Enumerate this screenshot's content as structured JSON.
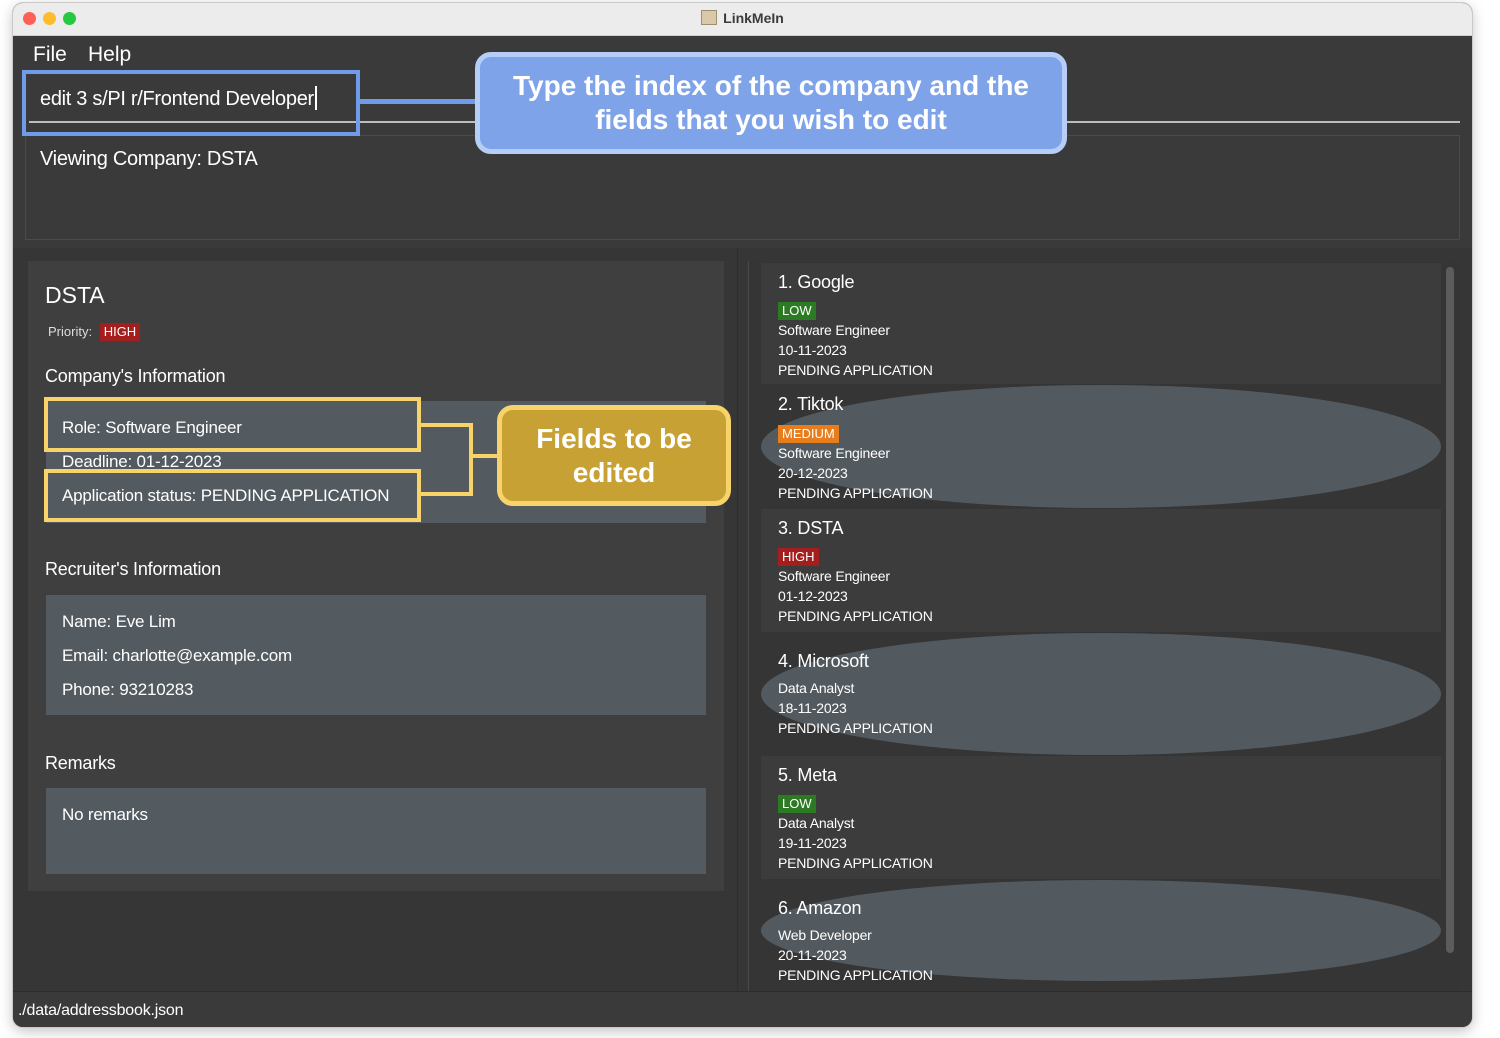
{
  "window": {
    "title": "LinkMeIn"
  },
  "menu": {
    "file": "File",
    "help": "Help"
  },
  "command": {
    "value": "edit 3 s/PI r/Frontend Developer"
  },
  "result": {
    "text": "Viewing Company: DSTA"
  },
  "detail": {
    "name": "DSTA",
    "priority_label": "Priority:",
    "priority": "HIGH",
    "company_section": "Company's Information",
    "role": "Role: Software Engineer",
    "deadline": "Deadline: 01-12-2023",
    "status": "Application status: PENDING APPLICATION",
    "recruiter_section": "Recruiter's Information",
    "recruiter_name": "Name: Eve Lim",
    "recruiter_email": "Email: charlotte@example.com",
    "recruiter_phone": "Phone: 93210283",
    "remarks_section": "Remarks",
    "remarks": "No remarks"
  },
  "companies": [
    {
      "title": "1.  Google",
      "priority": "LOW",
      "role": "Software Engineer",
      "deadline": "10-11-2023",
      "status": "PENDING APPLICATION"
    },
    {
      "title": "2.  Tiktok",
      "priority": "MEDIUM",
      "role": "Software Engineer",
      "deadline": "20-12-2023",
      "status": "PENDING APPLICATION"
    },
    {
      "title": "3.  DSTA",
      "priority": "HIGH",
      "role": "Software Engineer",
      "deadline": "01-12-2023",
      "status": "PENDING APPLICATION"
    },
    {
      "title": "4.  Microsoft",
      "priority": "",
      "role": "Data Analyst",
      "deadline": "18-11-2023",
      "status": "PENDING APPLICATION"
    },
    {
      "title": "5.  Meta",
      "priority": "LOW",
      "role": "Data Analyst",
      "deadline": "19-11-2023",
      "status": "PENDING APPLICATION"
    },
    {
      "title": "6.  Amazon",
      "priority": "",
      "role": "Web Developer",
      "deadline": "20-11-2023",
      "status": "PENDING APPLICATION"
    }
  ],
  "statusbar": {
    "path": "./data/addressbook.json"
  },
  "annotations": {
    "command_callout": "Type the index of the company and the fields that you wish to edit",
    "fields_callout": "Fields to be edited"
  },
  "colors": {
    "priority_high": "#a51e1e",
    "priority_medium": "#e87d1e",
    "priority_low": "#2c7a23",
    "callout_blue": "#7ea3e8",
    "callout_yellow": "#c7a134"
  }
}
